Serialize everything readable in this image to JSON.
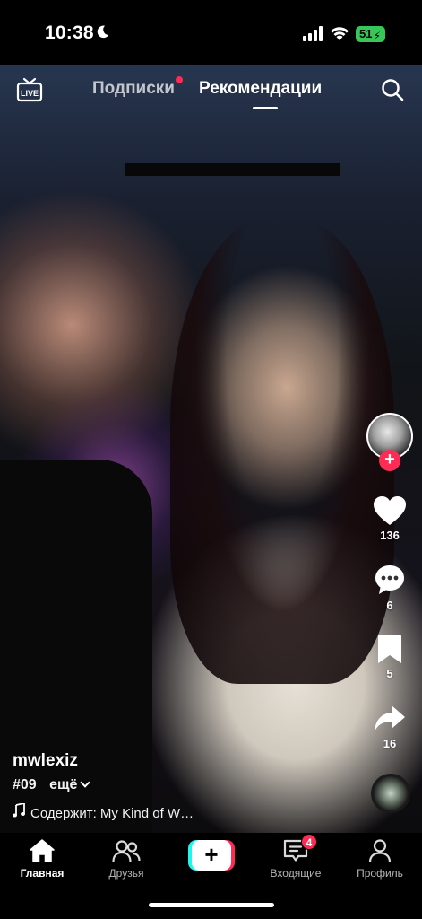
{
  "status_bar": {
    "time": "10:38",
    "battery": "51",
    "icons": [
      "moon-icon",
      "signal-icon",
      "wifi-icon",
      "battery-icon"
    ]
  },
  "top_nav": {
    "live_icon": "live-tv-icon",
    "tabs": [
      {
        "label": "Подписки",
        "active": false,
        "has_dot": true
      },
      {
        "label": "Рекомендации",
        "active": true
      }
    ],
    "search_icon": "search-icon"
  },
  "rail": {
    "follow_icon": "plus-icon",
    "likes": "136",
    "comments": "6",
    "saves": "5",
    "shares": "16"
  },
  "post": {
    "username": "mwlexiz",
    "caption": "#09",
    "more_label": "ещё",
    "sound_label": "Содержит: My Kind of W…"
  },
  "bottom_nav": {
    "items": [
      {
        "label": "Главная",
        "icon": "home-icon",
        "active": true
      },
      {
        "label": "Друзья",
        "icon": "friends-icon",
        "active": false
      },
      {
        "label": "",
        "icon": "plus-icon",
        "active": false
      },
      {
        "label": "Входящие",
        "icon": "inbox-icon",
        "active": false
      },
      {
        "label": "Профиль",
        "icon": "profile-icon",
        "active": false
      }
    ],
    "inbox_badge": "4"
  },
  "colors": {
    "accent": "#fe2c55",
    "accent_cyan": "#25f4ee",
    "battery": "#37c759"
  }
}
